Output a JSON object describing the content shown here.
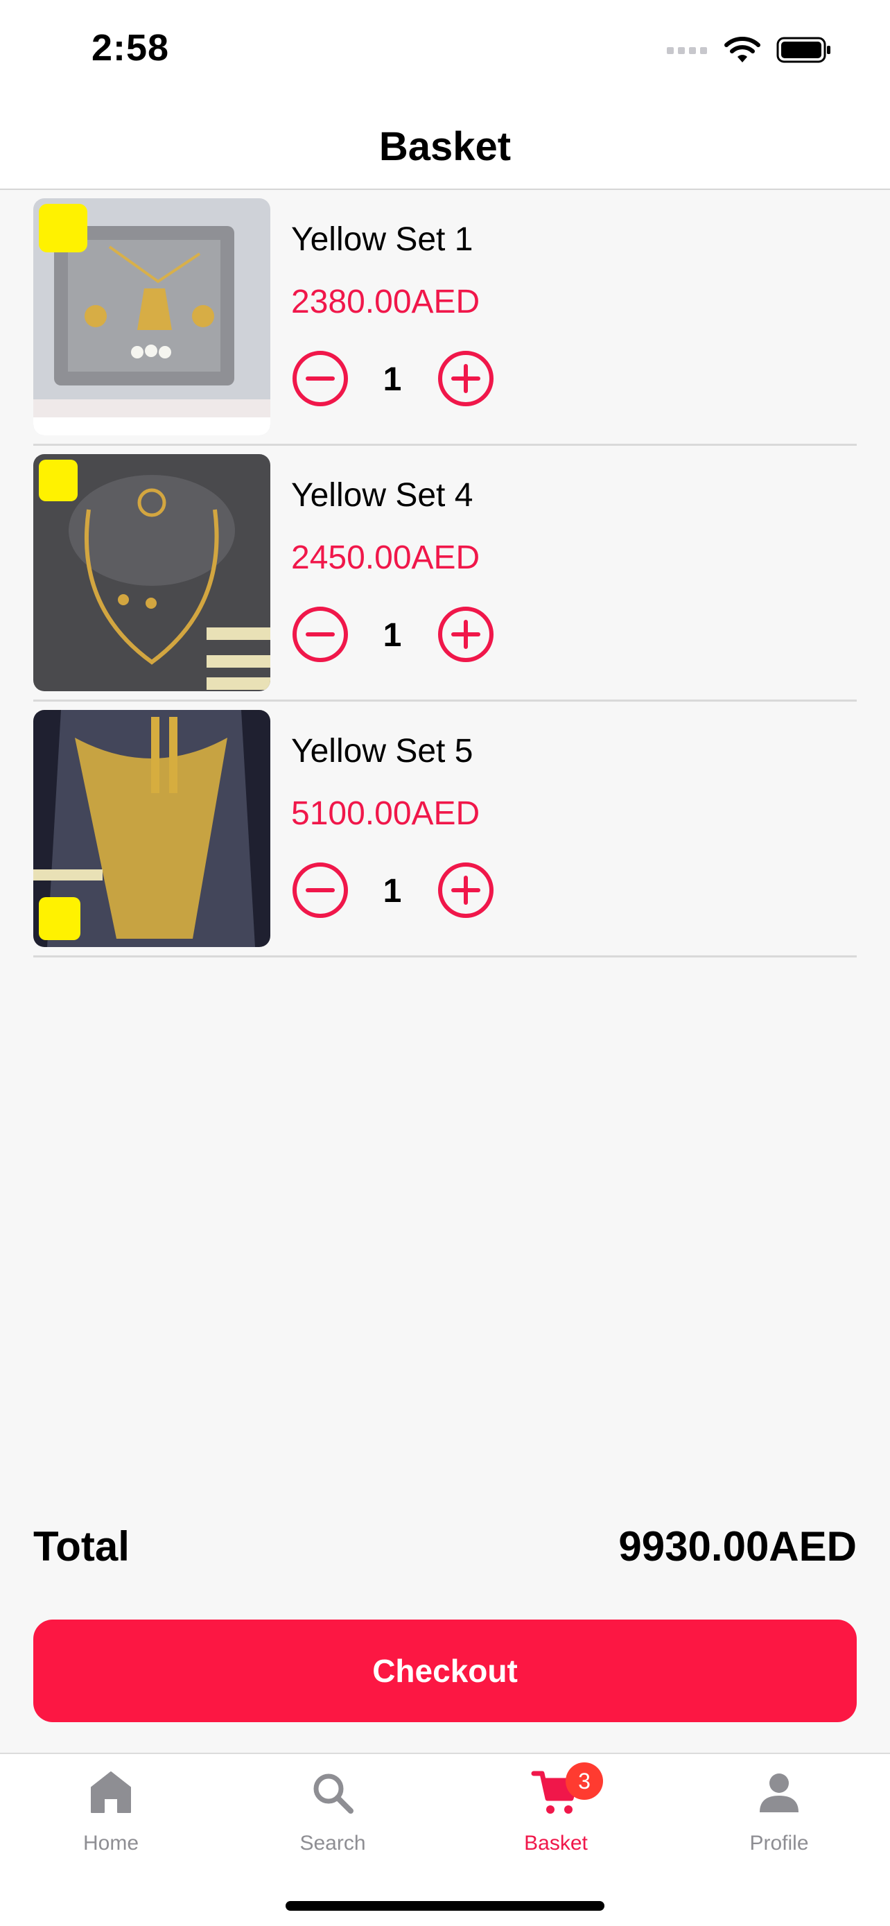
{
  "status_bar": {
    "time": "2:58"
  },
  "header": {
    "title": "Basket"
  },
  "items": [
    {
      "name": "Yellow Set 1",
      "price": "2380.00AED",
      "quantity": "1"
    },
    {
      "name": "Yellow Set 4",
      "price": "2450.00AED",
      "quantity": "1"
    },
    {
      "name": "Yellow Set 5",
      "price": "5100.00AED",
      "quantity": "1"
    }
  ],
  "summary": {
    "total_label": "Total",
    "total_value": "9930.00AED"
  },
  "checkout": {
    "label": "Checkout"
  },
  "tabs": [
    {
      "label": "Home",
      "icon": "home-icon"
    },
    {
      "label": "Search",
      "icon": "search-icon"
    },
    {
      "label": "Basket",
      "icon": "cart-icon",
      "badge": "3",
      "active": true
    },
    {
      "label": "Profile",
      "icon": "person-icon"
    }
  ],
  "colors": {
    "accent": "#f0174a",
    "button": "#fc1743",
    "badge": "#ff3b30",
    "inactive": "#8e8e93"
  }
}
